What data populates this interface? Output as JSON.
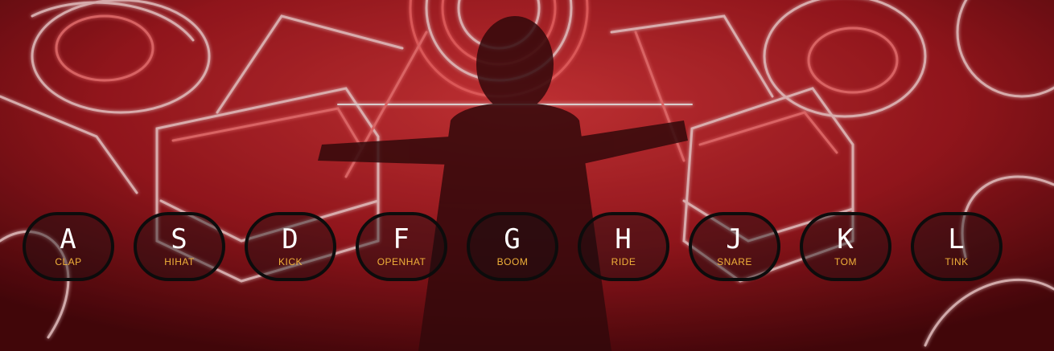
{
  "background": {
    "description_icon": "neon-instruments-background",
    "tint": "#c8232c"
  },
  "colors": {
    "key_border": "#0c0c0c",
    "key_letter": "#ffffff",
    "key_sound": "#f0b13a"
  },
  "keys": [
    {
      "key": "A",
      "sound": "CLAP"
    },
    {
      "key": "S",
      "sound": "HIHAT"
    },
    {
      "key": "D",
      "sound": "KICK"
    },
    {
      "key": "F",
      "sound": "OPENHAT"
    },
    {
      "key": "G",
      "sound": "BOOM"
    },
    {
      "key": "H",
      "sound": "RIDE"
    },
    {
      "key": "J",
      "sound": "SNARE"
    },
    {
      "key": "K",
      "sound": "TOM"
    },
    {
      "key": "L",
      "sound": "TINK"
    }
  ]
}
